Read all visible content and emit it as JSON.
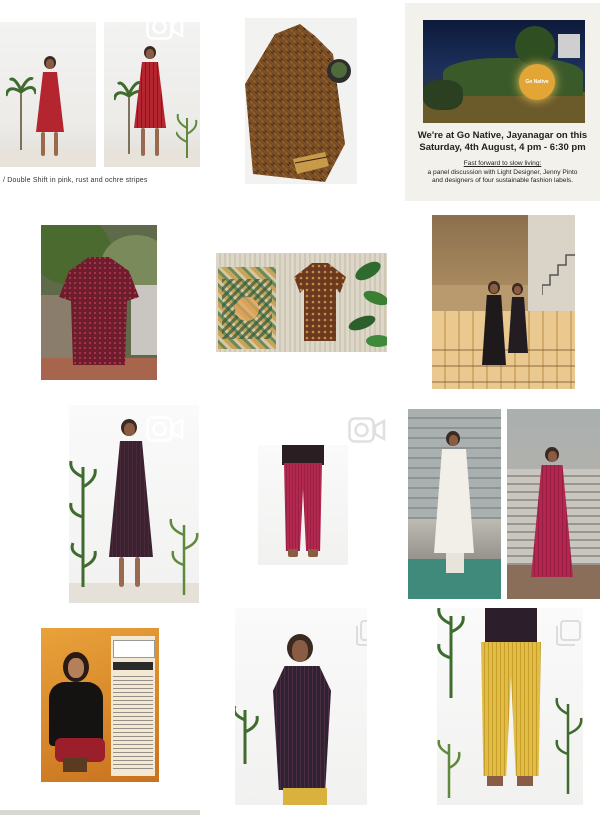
{
  "feed": {
    "caption_double_shift": "/ Double Shift in pink, rust and ochre stripes",
    "event": {
      "title_line1": "We're at Go Native, Jayanagar on this",
      "title_line2": "Saturday, 4th August, 4 pm - 6:30 pm",
      "sub_heading": "Fast forward to slow living:",
      "sub_line1": "a panel discussion with Light Designer, Jenny Pinto",
      "sub_line2": "and designers of four sustainable fashion labels.",
      "sign_text": "Go Native"
    }
  },
  "colors": {
    "background": "#ffffff",
    "icon": "#ffffff",
    "rust": "#8c1f2b",
    "ochre": "#d9b53a",
    "plum": "#3b2530"
  },
  "icons": {
    "video": "video-camera-icon",
    "multiple": "multiple-posts-icon"
  }
}
